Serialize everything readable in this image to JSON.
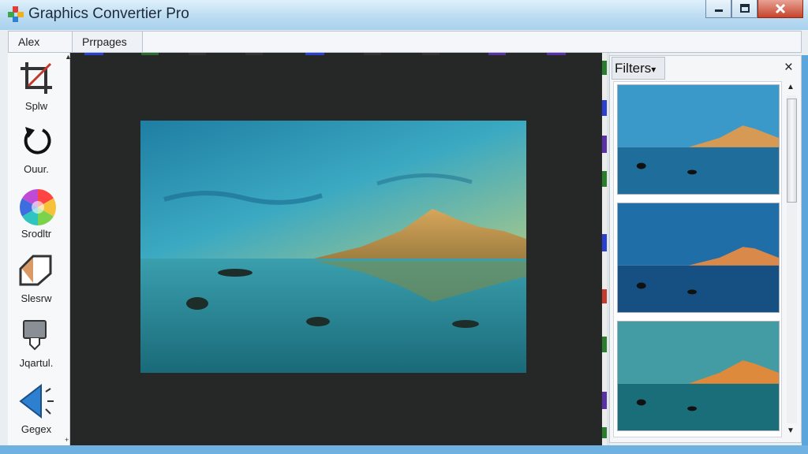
{
  "window": {
    "title": "Graphics Convertier Pro"
  },
  "tabs": [
    {
      "label": "Alex"
    },
    {
      "label": "Prrpages"
    }
  ],
  "tools": [
    {
      "label": "Splw",
      "icon": "crop-icon"
    },
    {
      "label": "Ouur.",
      "icon": "rotate-icon"
    },
    {
      "label": "Srodltr",
      "icon": "color-wheel-icon"
    },
    {
      "label": "Slesrw",
      "icon": "tag-shape-icon"
    },
    {
      "label": "Jqartul.",
      "icon": "funnel-icon"
    },
    {
      "label": "Gegex",
      "icon": "speaker-icon"
    }
  ],
  "filters": {
    "title": "Filters",
    "dropdown_glyph": "▾",
    "close_glyph": "×",
    "thumbnails": [
      {
        "name": "filter-thumbnail-1"
      },
      {
        "name": "filter-thumbnail-2"
      },
      {
        "name": "filter-thumbnail-3"
      }
    ]
  },
  "colors": {
    "titlebar": "#bcdcf1",
    "canvas": "#262727",
    "accent_blue": "#2d7fd0",
    "close_button": "#c6442c"
  }
}
